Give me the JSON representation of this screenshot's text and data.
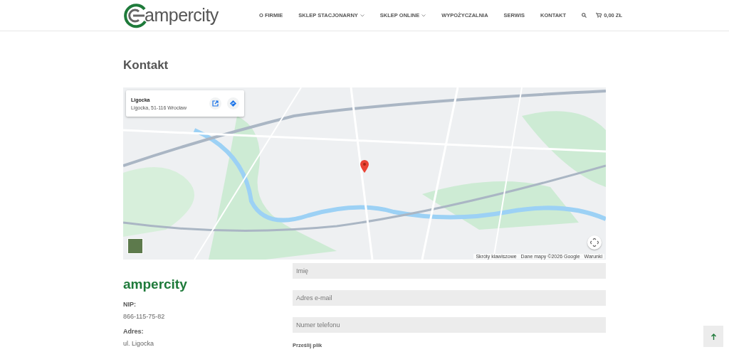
{
  "header": {
    "logo": "ampercity",
    "nav": [
      {
        "label": "O FIRMIE",
        "dropdown": false
      },
      {
        "label": "SKLEP STACJONARNY",
        "dropdown": true
      },
      {
        "label": "SKLEP ONLINE",
        "dropdown": true
      },
      {
        "label": "WYPOŻYCZALNIA",
        "dropdown": false
      },
      {
        "label": "SERWIS",
        "dropdown": false
      },
      {
        "label": "KONTAKT",
        "dropdown": false
      }
    ],
    "cart": "0,00 ZŁ"
  },
  "page_title": "Kontakt",
  "map": {
    "place_name": "Ligocka",
    "place_address": "Ligocka, 51-116 Wrocław",
    "footer_links": [
      "Skróty klawiszowe",
      "Dane mapy ©2026 Google",
      "Warunki"
    ]
  },
  "company": {
    "name": "ampercity",
    "details": [
      {
        "label": "NIP:",
        "value": "866-115-75-82"
      },
      {
        "label": "Adres:",
        "value": "ul. Ligocka"
      }
    ]
  },
  "form": {
    "fields": [
      {
        "placeholder": "Imię"
      },
      {
        "placeholder": "Adres e-mail"
      },
      {
        "placeholder": "Numer telefonu"
      }
    ],
    "file_label": "Prześlij plik"
  }
}
